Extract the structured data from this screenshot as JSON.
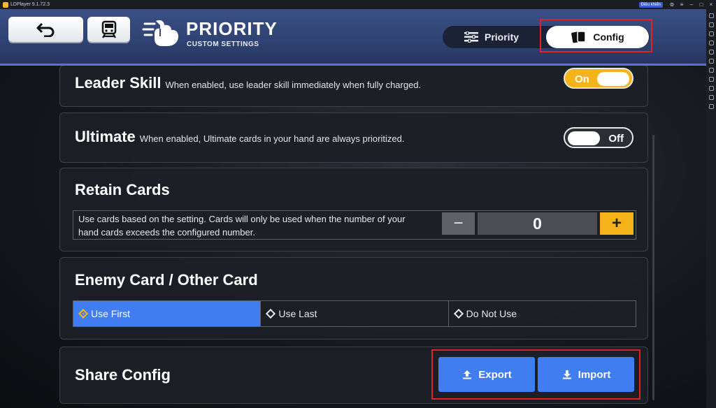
{
  "window": {
    "title": "LDPlayer 9.1.72.3",
    "control_badge": "Điều khiển"
  },
  "header": {
    "title": "PRIORITY",
    "subtitle": "CUSTOM SETTINGS"
  },
  "tabs": [
    {
      "label": "Priority",
      "icon": "sliders-icon",
      "active": false
    },
    {
      "label": "Config",
      "icon": "cards-icon",
      "active": true
    }
  ],
  "settings": {
    "leader_skill": {
      "title": "Leader Skill",
      "description": "When enabled, use leader skill immediately when fully charged.",
      "state": "On"
    },
    "ultimate": {
      "title": "Ultimate",
      "description": "When enabled, Ultimate cards in your hand are always prioritized.",
      "state": "Off"
    },
    "retain_cards": {
      "title": "Retain Cards",
      "description": "Use cards based on the setting. Cards will only be used when the number of your hand cards exceeds the configured number.",
      "value": "0",
      "minus": "−",
      "plus": "+"
    },
    "enemy_card": {
      "title": "Enemy Card / Other Card",
      "options": [
        "Use First",
        "Use Last",
        "Do Not Use"
      ],
      "selected": "Use First"
    },
    "share_config": {
      "title": "Share Config",
      "export_label": "Export",
      "import_label": "Import"
    }
  },
  "colors": {
    "accent_blue": "#3f7df0",
    "toggle_yellow": "#f3b319",
    "header_blue": "#34497c",
    "highlight_red": "#e02424"
  }
}
